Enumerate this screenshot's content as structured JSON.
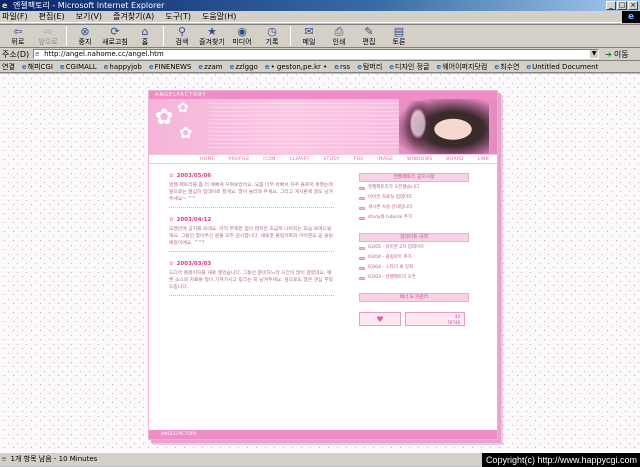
{
  "window": {
    "title": "- Microsoft Internet Explorer",
    "title_prefix": "엔젤팩토리",
    "controls": [
      "_",
      "□",
      "×"
    ]
  },
  "menubar": {
    "items": [
      "파일(F)",
      "편집(E)",
      "보기(V)",
      "즐겨찾기(A)",
      "도구(T)",
      "도움말(H)"
    ]
  },
  "toolbar": {
    "buttons": [
      {
        "label": "뒤로",
        "icon": "back-arrow-icon",
        "glyph": "⇦",
        "enabled": true
      },
      {
        "label": "앞으로",
        "icon": "forward-arrow-icon",
        "glyph": "⇨",
        "enabled": false
      },
      {
        "label": "중지",
        "icon": "stop-icon",
        "glyph": "⊗",
        "enabled": true
      },
      {
        "label": "새로고침",
        "icon": "refresh-icon",
        "glyph": "⟳",
        "enabled": true
      },
      {
        "label": "홈",
        "icon": "home-icon",
        "glyph": "⌂",
        "enabled": true
      },
      {
        "label": "검색",
        "icon": "search-icon",
        "glyph": "⚲",
        "enabled": true
      },
      {
        "label": "즐겨찾기",
        "icon": "favorites-icon",
        "glyph": "★",
        "enabled": true
      },
      {
        "label": "미디어",
        "icon": "media-icon",
        "glyph": "◉",
        "enabled": true
      },
      {
        "label": "기록",
        "icon": "history-icon",
        "glyph": "◷",
        "enabled": true
      },
      {
        "label": "메일",
        "icon": "mail-icon",
        "glyph": "✉",
        "enabled": true
      },
      {
        "label": "인쇄",
        "icon": "print-icon",
        "glyph": "⎙",
        "enabled": true
      },
      {
        "label": "편집",
        "icon": "edit-icon",
        "glyph": "✎",
        "enabled": true
      },
      {
        "label": "토론",
        "icon": "discuss-icon",
        "glyph": "▤",
        "enabled": true
      }
    ]
  },
  "address": {
    "label": "주소(D)",
    "url": "http://angel.nahome.cc/angel.htm",
    "go_label": "이동"
  },
  "links": {
    "label": "연결",
    "items": [
      "해피CGI",
      "CGIMALL",
      "happyjob",
      "FINENEWS",
      "zzam",
      "zzlggo",
      "• geston,pe.kr •",
      "rss",
      "탐머리",
      "디자인 정글",
      "웨어이퍼지닷컴",
      "최수연",
      "Untitled Document"
    ]
  },
  "site": {
    "name": "ANGELFACTORY",
    "nav": [
      "HOME",
      "PROFILE",
      "ICON",
      "CLIPART",
      "STUDY",
      "PDS",
      "IMAGE",
      "WINDOWS",
      "BOARD",
      "LINK"
    ],
    "posts": [
      {
        "date": "2003/05/06",
        "body": "엔젤 팩토리를 좀 더 예쁘게 꾸며보았어요. 요즘 너무 바빠서 자주 들르지 못했는데 앞으로는 열심히 업데이트 할게요. 많이 놀러와 주세요. 그리고 게시판에 글도 남겨주세요~ ^^"
      },
      {
        "date": "2003/04/12",
        "body": "오랜만에 공지를 쓰네요. 아직 부족한 점이 많지만 조금씩 나아지는 모습 보여드릴게요. 그동안 찾아주신 분들 모두 감사합니다. 새로운 클립아트와 아이콘도 곧 올릴 예정이에요. ^^*"
      },
      {
        "date": "2003/03/03",
        "body": "드디어 홈페이지를 새로 열었습니다. 그동안 준비하느라 시간이 많이 걸렸네요. 예쁜 소스와 자료들 많이 가져가시고 링크는 꼭 남겨주세요. 앞으로도 많은 관심 부탁드립니다."
      }
    ],
    "notice_title": "엔젤팩토리 공지사항",
    "notices": [
      "엔젤팩토리가 오픈했습니다",
      "아이콘 자료실 업데이트",
      "게시판 사용 안내입니다",
      "study와 tutorial 추가"
    ],
    "update_title": "업데이트 내역",
    "updates": [
      "03/05 - 아이콘 2차 업데이트",
      "03/04 - 클립아트 추가",
      "03/04 - 스타디 새 강좌",
      "03/03 - 엔젤팩토리 오픈"
    ],
    "extra_title": "배너 & 카운터",
    "counter_today": "42",
    "counter_total": "76746",
    "footer": "ANGELFACTORY"
  },
  "statusbar": {
    "text": "1개 항목 남음 - 10 Minutes",
    "copyright": "Copyright(c) http://www.happycgi.com"
  }
}
